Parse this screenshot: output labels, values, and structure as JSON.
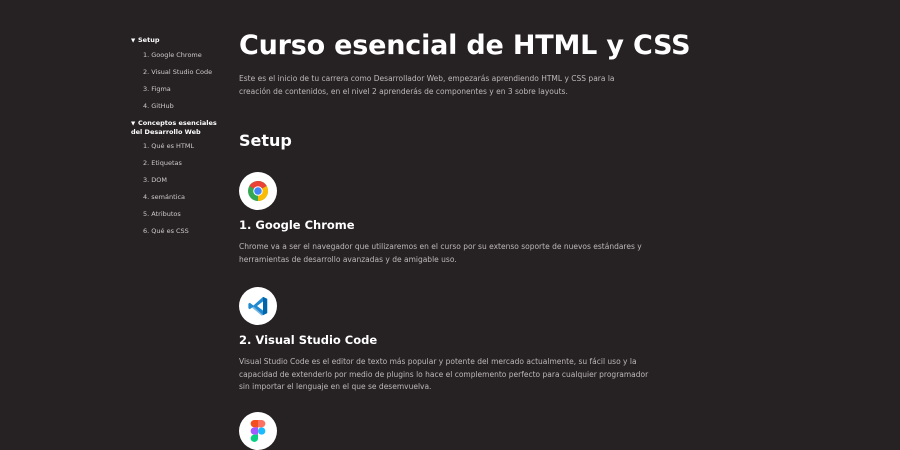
{
  "sidebar": {
    "sections": [
      {
        "title": "Setup",
        "items": [
          "1. Google Chrome",
          "2. Visual Studio Code",
          "3. Figma",
          "4. GitHub"
        ]
      },
      {
        "title": "Conceptos esenciales del Desarrollo Web",
        "items": [
          "1. Qué es HTML",
          "2. Etiquetas",
          "3. DOM",
          "4. semántica",
          "5. Atributos",
          "6. Qué es CSS"
        ]
      }
    ]
  },
  "main": {
    "title": "Curso esencial de HTML y CSS",
    "intro": "Este es el inicio de tu carrera como Desarrollador Web, empezarás aprendiendo HTML y CSS para la creación de contenidos, en el nivel 2 aprenderás de componentes y en 3 sobre layouts.",
    "section_title": "Setup",
    "items": [
      {
        "icon": "chrome-icon",
        "title": "1. Google Chrome",
        "desc": "Chrome va a ser el navegador que utilizaremos en el curso por su extenso soporte de nuevos estándares y herramientas de desarrollo avanzadas y de amigable uso."
      },
      {
        "icon": "vscode-icon",
        "title": "2. Visual Studio Code",
        "desc": "Visual Studio Code es el editor de texto más popular y potente del mercado actualmente, su fácil uso y la capacidad de extenderlo por medio de plugins lo hace el complemento perfecto para cualquier programador sin importar el lenguaje en el que se desemvuelva."
      },
      {
        "icon": "figma-icon"
      }
    ]
  },
  "colors": {
    "background": "#262123",
    "text": "#ffffff",
    "muted_text": "#bdb8ba"
  }
}
